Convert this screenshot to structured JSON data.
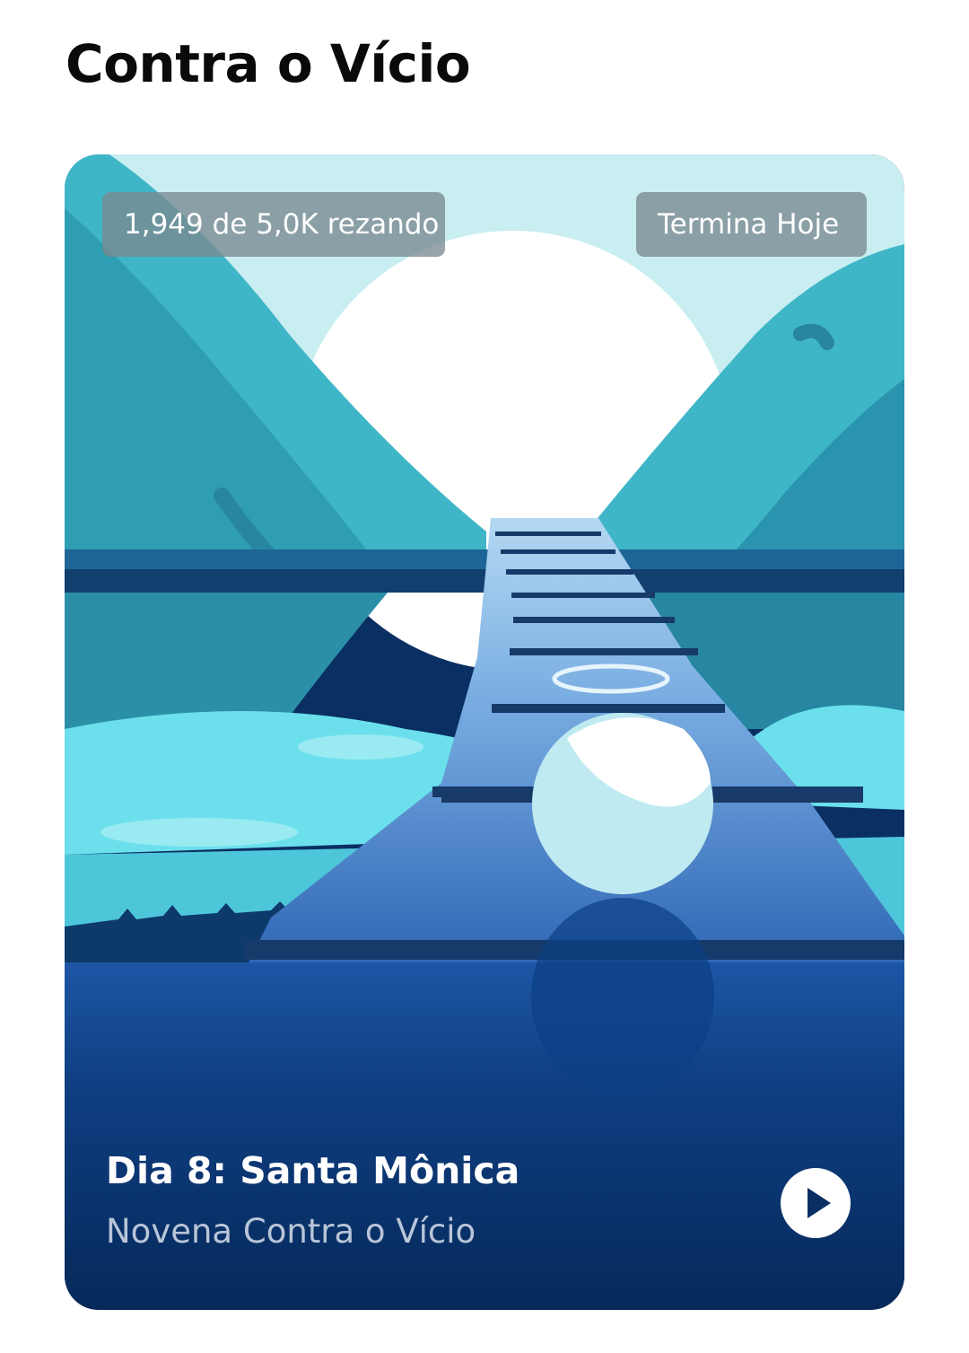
{
  "section": {
    "title": "Contra o Vício"
  },
  "card": {
    "participants_label": "1,949 de 5,0K rezando",
    "ends_label": "Termina Hoje",
    "title": "Dia 8: Santa Mônica",
    "subtitle": "Novena Contra o Vício",
    "play_icon": "play-icon",
    "artwork": "landscape-illustration"
  },
  "colors": {
    "sky": "#c9eef1",
    "mountain": "#3aa9bb",
    "water": "#5fd5e6",
    "deep_blue": "#0a2f63",
    "chip_bg": "#7a8a91"
  }
}
